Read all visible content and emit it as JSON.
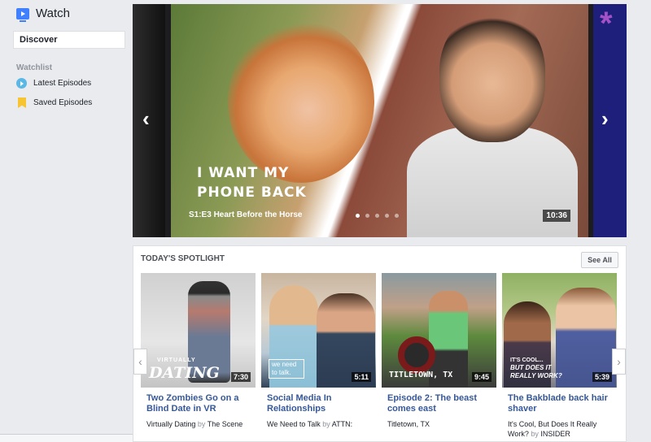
{
  "sidebar": {
    "app_title": "Watch",
    "discover": "Discover",
    "watchlist_heading": "Watchlist",
    "items": [
      {
        "label": "Latest Episodes",
        "icon": "play-circle-icon"
      },
      {
        "label": "Saved Episodes",
        "icon": "bookmark-icon"
      }
    ]
  },
  "carousel": {
    "logo_line1": "I WANT MY",
    "logo_line2": "PHONE BACK",
    "caption": "S1:E3 Heart Before the Horse",
    "duration": "10:36",
    "dots": 5,
    "active_dot": 0,
    "prev_icon": "chevron-left-icon",
    "next_icon": "chevron-right-icon"
  },
  "spotlight": {
    "title": "TODAY'S SPOTLIGHT",
    "see_all": "See All",
    "cards": [
      {
        "overlay": "DATING",
        "overlay_small": "VIRTUALLY",
        "duration": "7:30",
        "title": "Two Zombies Go on a Blind Date in VR",
        "show": "Virtually Dating",
        "by": "by",
        "publisher": "The Scene"
      },
      {
        "overlay": "we need to talk.",
        "overlay_small": "",
        "duration": "5:11",
        "title": "Social Media In Relationships",
        "show": "We Need to Talk",
        "by": "by",
        "publisher": "ATTN:"
      },
      {
        "overlay": "TITLETOWN, TX",
        "overlay_small": "",
        "duration": "9:45",
        "title": "Episode 2: The beast comes east",
        "show": "Titletown, TX",
        "by": "",
        "publisher": ""
      },
      {
        "overlay": "BUT DOES IT REALLY WORK?",
        "overlay_small": "IT'S COOL...",
        "duration": "5:39",
        "title": "The Bakblade back hair shaver",
        "show": "It's Cool, But Does It Really Work?",
        "by": "by",
        "publisher": "INSIDER"
      }
    ]
  }
}
